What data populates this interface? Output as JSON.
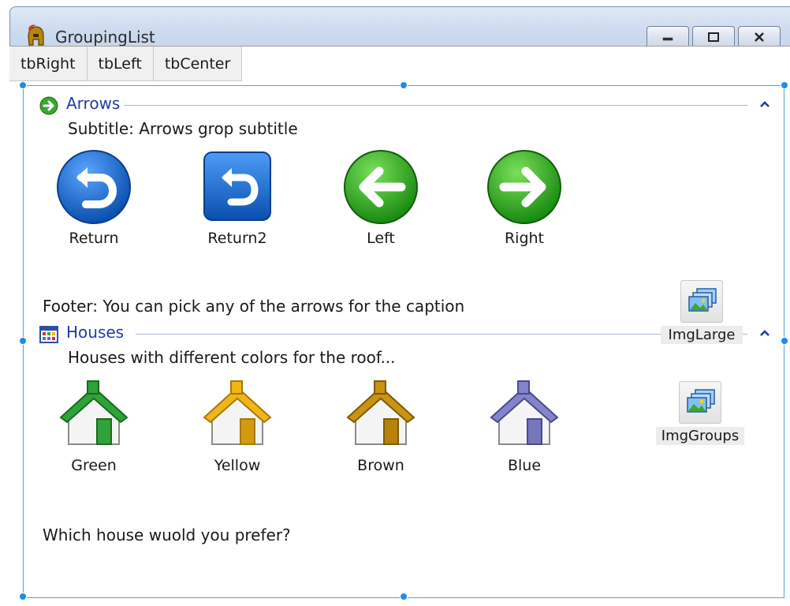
{
  "window": {
    "title": "GroupingList"
  },
  "tabs": [
    {
      "label": "tbRight"
    },
    {
      "label": "tbLeft"
    },
    {
      "label": "tbCenter"
    }
  ],
  "groups": {
    "arrows": {
      "caption": "Arrows",
      "subtitle": "Subtitle: Arrows grop subtitle",
      "footer": "Footer: You can pick any of the arrows for the caption",
      "items": [
        {
          "label": "Return",
          "icon": "return-round-icon"
        },
        {
          "label": "Return2",
          "icon": "return-square-icon"
        },
        {
          "label": "Left",
          "icon": "arrow-left-icon"
        },
        {
          "label": "Right",
          "icon": "arrow-right-icon"
        }
      ]
    },
    "houses": {
      "caption": "Houses",
      "subtitle": "Houses with different colors for the roof...",
      "footer": "Which house wuold you prefer?",
      "items": [
        {
          "label": "Green",
          "icon": "house-green-icon",
          "roof": "#2fa23a"
        },
        {
          "label": "Yellow",
          "icon": "house-yellow-icon",
          "roof": "#f1b518"
        },
        {
          "label": "Brown",
          "icon": "house-brown-icon",
          "roof": "#c99414"
        },
        {
          "label": "Blue",
          "icon": "house-blue-icon",
          "roof": "#8484cc"
        }
      ]
    }
  },
  "side_buttons": [
    {
      "label": "ImgLarge"
    },
    {
      "label": "ImgGroups"
    }
  ],
  "colors": {
    "accent": "#1e8ce8",
    "group_caption": "#1f3da6",
    "arrow_green": "#3aa82d",
    "return_blue": "#1565c8"
  }
}
